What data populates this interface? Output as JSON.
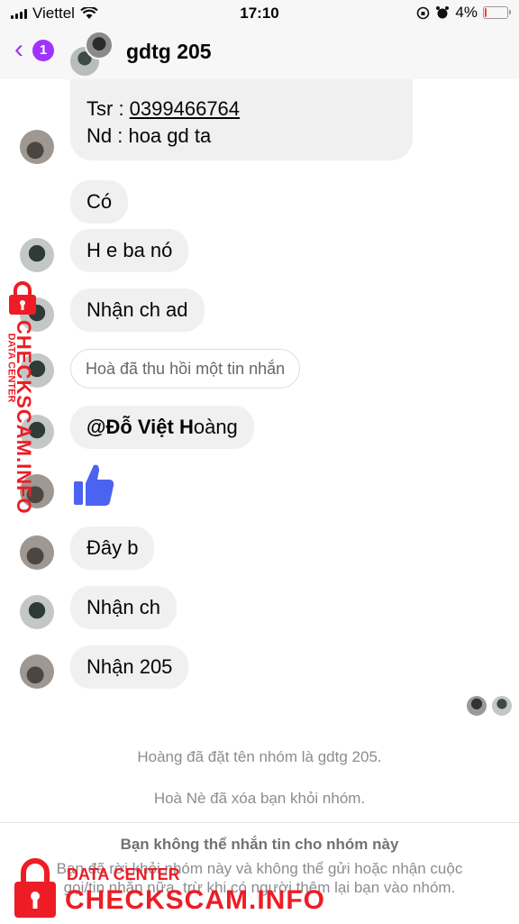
{
  "status_bar": {
    "carrier": "Viettel",
    "time": "17:10",
    "battery": "4%"
  },
  "header": {
    "back_badge": "1",
    "title": "gdtg 205"
  },
  "messages": [
    {
      "line1_prefix": "Tsr : ",
      "line1_link": "0399466764",
      "line2": "Nd : hoa gd ta"
    },
    {
      "text": "Có"
    },
    {
      "text": "H e ba nó"
    },
    {
      "text": "Nhận ch ad"
    },
    {
      "text": "Hoà đã thu hồi một tin nhắn"
    },
    {
      "mention_bold": "@Đỗ Việt H",
      "mention_rest": "oàng"
    },
    {
      "type": "like",
      "icon": "thumbs-up-icon"
    },
    {
      "text": "Đây b"
    },
    {
      "text": "Nhận ch"
    },
    {
      "text": "Nhận 205"
    }
  ],
  "system_messages": [
    "Hoàng đã đặt tên nhóm là gdtg 205.",
    "Hoà Nè đã xóa bạn khỏi nhóm."
  ],
  "footer": {
    "title": "Bạn không thể nhắn tin cho nhóm này",
    "text": "Bạn đã rời khỏi nhóm này và không thể gửi hoặc nhận cuộc gọi/tin nhắn nữa, trừ khi có người thêm lại bạn vào nhóm."
  },
  "watermark": {
    "sub": "DATA CENTER",
    "main": "CHECKSCAM.INFO"
  },
  "colors": {
    "accent": "#a033ff",
    "like_blue": "#4a63f0",
    "watermark_red": "#ee1c25",
    "bubble_gray": "#f0f0f0"
  }
}
